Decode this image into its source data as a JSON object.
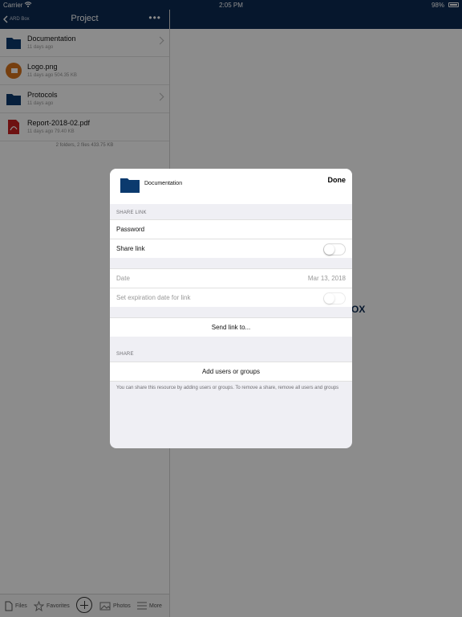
{
  "status_bar": {
    "carrier": "Carrier",
    "time": "2:05 PM",
    "battery": "98%"
  },
  "nav": {
    "back_label": "ARD Box",
    "title": "Project",
    "more_label": "•••"
  },
  "files": [
    {
      "name": "Documentation",
      "meta": "11 days ago",
      "icon": "folder-icon",
      "has_chevron": true
    },
    {
      "name": "Logo.png",
      "meta": "11 days ago 504.35 KB",
      "icon": "image-icon",
      "has_chevron": false
    },
    {
      "name": "Protocols",
      "meta": "11 days ago",
      "icon": "folder-icon",
      "has_chevron": true
    },
    {
      "name": "Report-2018-02.pdf",
      "meta": "11 days ago 79.40 KB",
      "icon": "pdf-icon",
      "has_chevron": false
    }
  ],
  "list_summary": "2 folders, 2 files 433.75 KB",
  "tabs": {
    "files": "Files",
    "favorites": "Favorites",
    "photos": "Photos",
    "more": "More"
  },
  "background_text": "OX",
  "modal": {
    "title": "Documentation",
    "done_label": "Done",
    "share_link_header": "SHARE LINK",
    "password_label": "Password",
    "share_link_label": "Share link",
    "date_label": "Date",
    "date_value": "Mar 13, 2018",
    "expiration_label": "Set expiration date for link",
    "send_link_label": "Send link to...",
    "share_header": "SHARE",
    "add_users_label": "Add users or groups",
    "footnote": "You can share this resource by adding users or groups. To remove a share, remove all users and groups"
  },
  "colors": {
    "nav_bg": "#0b2a52",
    "folder": "#0b3a6e",
    "image_icon": "#d8731c",
    "pdf_icon": "#c8201f"
  }
}
